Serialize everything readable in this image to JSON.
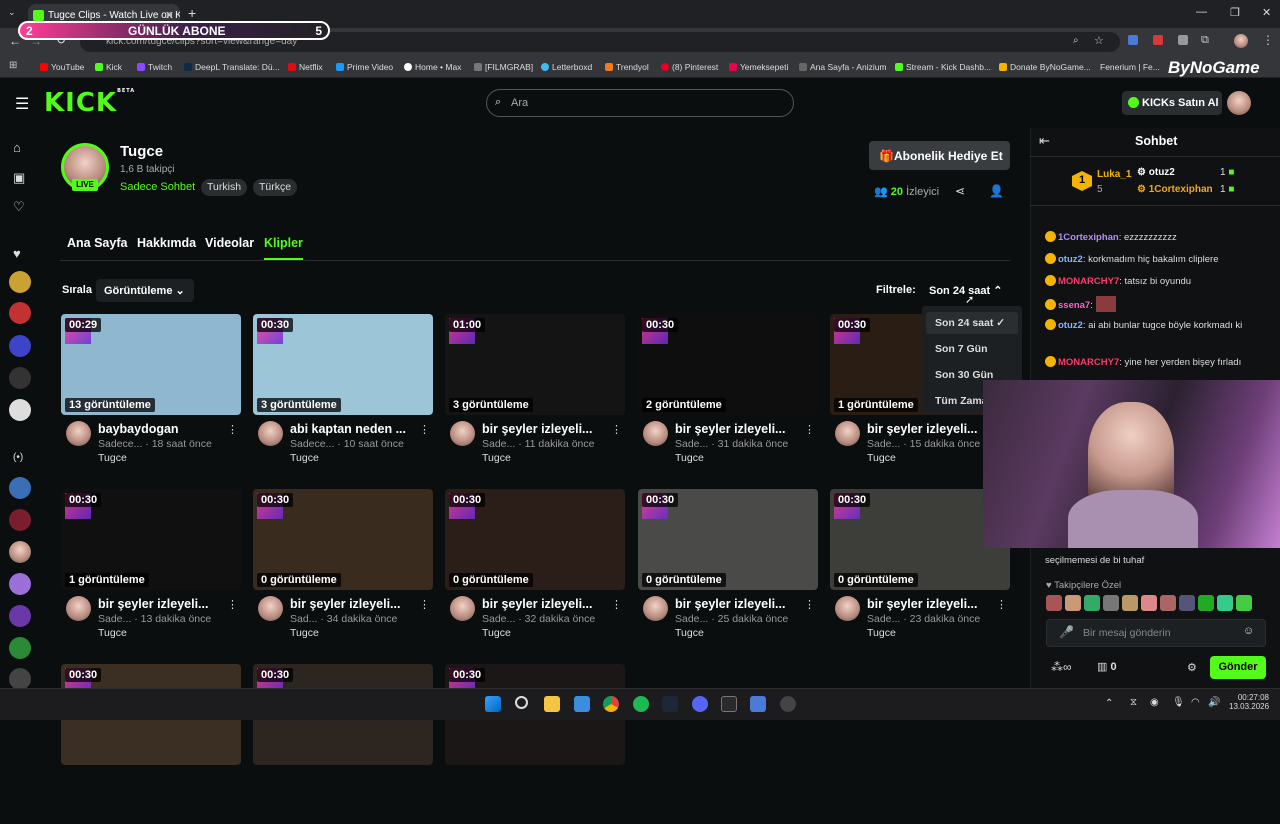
{
  "browser": {
    "tab_title": "Tugce Clips - Watch Live on Kick",
    "url": "kick.com/tugce/clips?sort=view&range=day",
    "bookmarks": [
      "YouTube",
      "Kick",
      "Twitch",
      "DeepL Translate: Dü...",
      "Netflix",
      "Prime Video",
      "Home • Max",
      "[FILMGRAB]",
      "Letterboxd",
      "Trendyol",
      "(8) Pinterest",
      "Yemeksepeti",
      "Ana Sayfa - Anizium",
      "Stream - Kick Dashb...",
      "Donate ByNoGame...",
      "Fenerium | Fe..."
    ]
  },
  "overlay": {
    "abone_count_left": "2",
    "abone_label": "GÜNLÜK ABONE",
    "abone_count_right": "5",
    "brand": "ByNoGame"
  },
  "header": {
    "logo": "KICK",
    "logo_beta": "BETA",
    "search_placeholder": "Ara",
    "buy_kicks": "KICKs Satın Al"
  },
  "channel": {
    "name": "Tugce",
    "followers": "1,6 B takipçi",
    "category": "Sadece Sohbet",
    "tags": [
      "Turkish",
      "Türkçe"
    ],
    "live_badge": "LIVE",
    "gift_sub": "Abonelik Hediye Et",
    "viewers_count": "20",
    "viewers_label": "İzleyici",
    "tabs": [
      "Ana Sayfa",
      "Hakkımda",
      "Videolar",
      "Klipler"
    ]
  },
  "clips_controls": {
    "sort_label": "Sırala",
    "sort_value": "Görüntüleme",
    "filter_label": "Filtrele:",
    "filter_value": "Son 24 saat",
    "filter_options": [
      "Son 24 saat",
      "Son 7 Gün",
      "Son 30 Gün",
      "Tüm Zamanlar"
    ]
  },
  "clips": [
    {
      "duration": "00:29",
      "views": "13 görüntüleme",
      "title": "baybaydogan",
      "meta": "Sadece... · 18 saat önce",
      "author": "Tugce",
      "thumb": "#8fb7cf"
    },
    {
      "duration": "00:30",
      "views": "3 görüntüleme",
      "title": "abi kaptan neden ...",
      "meta": "Sadece... · 10 saat önce",
      "author": "Tugce",
      "thumb": "#9cc6d8"
    },
    {
      "duration": "01:00",
      "views": "3 görüntüleme",
      "title": "bir şeyler izleyeli...",
      "meta": "Sade... · 11 dakika önce",
      "author": "Tugce",
      "thumb": "#141414"
    },
    {
      "duration": "00:30",
      "views": "2 görüntüleme",
      "title": "bir şeyler izleyeli...",
      "meta": "Sade... · 31 dakika önce",
      "author": "Tugce",
      "thumb": "#0e0e0e"
    },
    {
      "duration": "00:30",
      "views": "1 görüntüleme",
      "title": "bir şeyler izleyeli...",
      "meta": "Sade... · 15 dakika önce",
      "author": "Tugce",
      "thumb": "#2a1d14"
    },
    {
      "duration": "00:30",
      "views": "1 görüntüleme",
      "title": "bir şeyler izleyeli...",
      "meta": "Sade... · 13 dakika önce",
      "author": "Tugce",
      "thumb": "#101010"
    },
    {
      "duration": "00:30",
      "views": "0 görüntüleme",
      "title": "bir şeyler izleyeli...",
      "meta": "Sad... · 34 dakika önce",
      "author": "Tugce",
      "thumb": "#3a2b1f"
    },
    {
      "duration": "00:30",
      "views": "0 görüntüleme",
      "title": "bir şeyler izleyeli...",
      "meta": "Sade... · 32 dakika önce",
      "author": "Tugce",
      "thumb": "#2b1d18"
    },
    {
      "duration": "00:30",
      "views": "0 görüntüleme",
      "title": "bir şeyler izleyeli...",
      "meta": "Sade... · 25 dakika önce",
      "author": "Tugce",
      "thumb": "#4a4a48"
    },
    {
      "duration": "00:30",
      "views": "0 görüntüleme",
      "title": "bir şeyler izleyeli...",
      "meta": "Sade... · 23 dakika önce",
      "author": "Tugce",
      "thumb": "#3d3e3a"
    },
    {
      "duration": "00:30",
      "views": "",
      "title": "",
      "meta": "",
      "author": "",
      "thumb": "#3b2f23"
    },
    {
      "duration": "00:30",
      "views": "",
      "title": "",
      "meta": "",
      "author": "",
      "thumb": "#2c2520"
    },
    {
      "duration": "00:30",
      "views": "",
      "title": "",
      "meta": "",
      "author": "",
      "thumb": "#1a1716"
    }
  ],
  "chat": {
    "title": "Sohbet",
    "leader_rank": "1",
    "leader_1": {
      "name": "Luka_1",
      "count": "5"
    },
    "leader_2": {
      "name": "otuz2",
      "count": "1"
    },
    "leader_3": {
      "name": "1Cortexiphan",
      "count": "1"
    },
    "messages": [
      {
        "user": "1Cortexiphan",
        "text": "ezzzzzzzzzz",
        "color": "#b48cff"
      },
      {
        "user": "otuz2",
        "text": "korkmadım hiç bakalım cliplere",
        "color": "#89b4ff"
      },
      {
        "user": "MONARCHY7",
        "text": "tatsız bi oyundu",
        "color": "#ff3b6b"
      },
      {
        "user": "ssena7",
        "text": "",
        "color": "#ff5fc8"
      },
      {
        "user": "otuz2",
        "text": "ai abi bunlar tugce böyle korkmadı ki",
        "color": "#89b4ff"
      },
      {
        "user": "MONARCHY7",
        "text": "yine her yerden bişey fırladı",
        "color": "#ff3b6b"
      },
      {
        "user": "",
        "text": "seçilmemesi de bi tuhaf",
        "color": "#ddd"
      }
    ],
    "followers_only": "Takipçilere Özel",
    "input_placeholder": "Bir mesaj gönderin",
    "points": "0",
    "send": "Gönder"
  },
  "taskbar": {
    "time": "00:27:08",
    "date": "13.03.2026"
  },
  "colors": {
    "accent": "#53fc18",
    "background": "#0b0e0f"
  }
}
